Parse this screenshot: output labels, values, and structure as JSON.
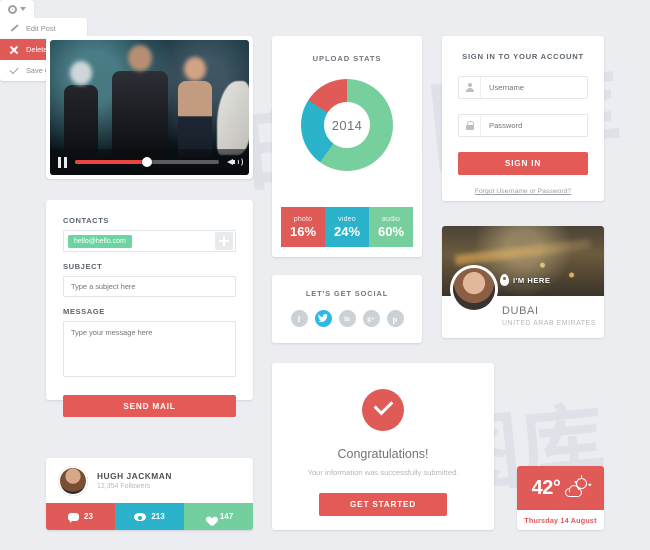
{
  "video": {
    "pause_icon": "pause-icon",
    "volume_icon": "volume-icon",
    "progress_percent": 50
  },
  "contact_form": {
    "contacts_label": "CONTACTS",
    "contact_tag": "hello@hello.com",
    "add_icon": "plus-icon",
    "subject_label": "SUBJECT",
    "subject_placeholder": "Type a subject here",
    "subject_value": "",
    "message_label": "MESSAGE",
    "message_placeholder": "Type your message here",
    "message_value": "",
    "send_button": "SEND MAIL"
  },
  "profile": {
    "name": "HUGH JACKMAN",
    "followers": "12,354 Followers",
    "avatar_icon": "avatar",
    "stats": [
      {
        "icon": "comment-icon",
        "value": "23",
        "color": "#e05a57"
      },
      {
        "icon": "eye-icon",
        "value": "213",
        "color": "#2ab3cb"
      },
      {
        "icon": "heart-icon",
        "value": "147",
        "color": "#74cf9e"
      }
    ]
  },
  "upload_stats": {
    "title": "UPLOAD STATS",
    "center_label": "2014"
  },
  "chart_data": {
    "type": "pie",
    "title": "UPLOAD STATS",
    "center_label": "2014",
    "categories": [
      "photo",
      "video",
      "audio"
    ],
    "values": [
      16,
      24,
      60
    ],
    "value_labels": [
      "16%",
      "24%",
      "60%"
    ],
    "colors": [
      "#e05a57",
      "#2ab3cb",
      "#78cf9e"
    ],
    "legend": "bottom",
    "donut": true,
    "inner_radius_ratio": 0.5
  },
  "social": {
    "title": "LET'S GET SOCIAL",
    "icons": [
      {
        "name": "facebook-icon",
        "glyph": "f",
        "active": false
      },
      {
        "name": "twitter-icon",
        "glyph": "t",
        "active": true
      },
      {
        "name": "linkedin-icon",
        "glyph": "in",
        "active": false
      },
      {
        "name": "google-plus-icon",
        "glyph": "g+",
        "active": false
      },
      {
        "name": "pinterest-icon",
        "glyph": "p",
        "active": false
      }
    ]
  },
  "congrats": {
    "check_icon": "check-icon",
    "heading": "Congratulations!",
    "message": "Your information was successfully submitted.",
    "button": "GET STARTED"
  },
  "signin": {
    "title": "SIGN IN TO YOUR ACCOUNT",
    "username_icon": "person-icon",
    "username_placeholder": "Username",
    "username_value": "",
    "password_icon": "lock-icon",
    "password_placeholder": "Password",
    "password_value": "",
    "button": "SIGN IN",
    "forgot_link": "Forgot Username or Password?"
  },
  "location": {
    "badge": "I'M HERE",
    "pin_icon": "map-pin-icon",
    "city": "DUBAI",
    "country": "UNITED ARAB EMIRATES",
    "avatar_icon": "avatar"
  },
  "dropdown": {
    "gear_icon": "gear-icon",
    "caret_icon": "chevron-down-icon",
    "items": [
      {
        "label": "Edit Post",
        "icon": "pencil-icon",
        "highlighted": false
      },
      {
        "label": "Delete Post",
        "icon": "x-icon",
        "highlighted": true
      },
      {
        "label": "Save Changes",
        "icon": "check-icon",
        "highlighted": false
      }
    ]
  },
  "weather": {
    "temperature": "42°",
    "condition_icon": "sun-cloud-icon",
    "date": "Thursday 14 August"
  },
  "watermark": "白马图库",
  "colors": {
    "background": "#ecedf1",
    "red": "#e05a57",
    "teal": "#2ab3cb",
    "green": "#78cf9e",
    "blue": "#2eb8e5"
  }
}
